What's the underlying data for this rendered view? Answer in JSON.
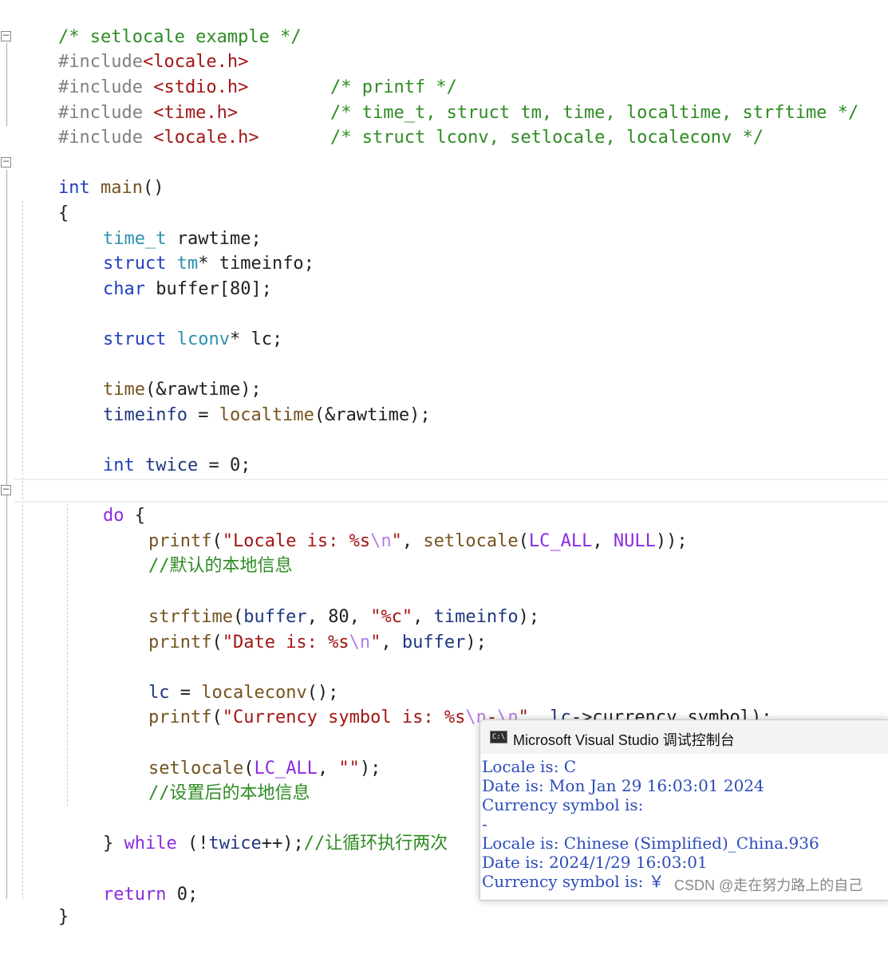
{
  "editor": {
    "lines": {
      "l01": {
        "cmt": "/* setlocale example */"
      },
      "l02": {
        "inc": "#include",
        "hdr": "<locale.h>"
      },
      "l03": {
        "inc": "#include",
        "hdr": "<stdio.h>",
        "cmt": "/* printf */"
      },
      "l04": {
        "inc": "#include",
        "hdr": "<time.h>",
        "cmt": "/* time_t, struct tm, time, localtime, strftime */"
      },
      "l05": {
        "inc": "#include",
        "hdr": "<locale.h>",
        "cmt": "/* struct lconv, setlocale, localeconv */"
      },
      "l07": {
        "kw": "int",
        "fn": "main",
        "punc": "()"
      },
      "l08": {
        "punc": "{"
      },
      "l09": {
        "type": "time_t",
        "var": "rawtime",
        "punc": ";"
      },
      "l10": {
        "kw": "struct",
        "type": "tm",
        "op": "*",
        "var": "timeinfo",
        "punc": ";"
      },
      "l11": {
        "kw": "char",
        "var": "buffer",
        "punc": "[80];"
      },
      "l13": {
        "kw": "struct",
        "type": "lconv",
        "op": "*",
        "var": "lc",
        "punc": ";"
      },
      "l15": {
        "fn": "time",
        "p1": "(&",
        "var": "rawtime",
        "p2": ");"
      },
      "l16": {
        "var": "timeinfo",
        "op": " = ",
        "fn": "localtime",
        "p1": "(&",
        "var2": "rawtime",
        "p2": ");"
      },
      "l18": {
        "kw": "int",
        "var": "twice",
        "op": " = ",
        "num": "0",
        "punc": ";"
      },
      "l20": {
        "kw": "do",
        "punc": " {"
      },
      "l21": {
        "fn": "printf",
        "p1": "(",
        "str1": "\"Locale is: %s",
        "esc": "\\n",
        "str2": "\"",
        "p2": ", ",
        "fn2": "setlocale",
        "p3": "(",
        "mac1": "LC_ALL",
        "p4": ", ",
        "mac2": "NULL",
        "p5": "));"
      },
      "l22": {
        "cmt": "//默认的本地信息"
      },
      "l24": {
        "fn": "strftime",
        "p1": "(",
        "var": "buffer",
        "p2": ", ",
        "num": "80",
        "p3": ", ",
        "str": "\"%c\"",
        "p4": ", ",
        "var2": "timeinfo",
        "p5": ");"
      },
      "l25": {
        "fn": "printf",
        "p1": "(",
        "str1": "\"Date is: %s",
        "esc": "\\n",
        "str2": "\"",
        "p2": ", ",
        "var": "buffer",
        "p3": ");"
      },
      "l27": {
        "var": "lc",
        "op": " = ",
        "fn": "localeconv",
        "punc": "();"
      },
      "l28": {
        "fn": "printf",
        "p1": "(",
        "str1": "\"Currency symbol is: %s",
        "esc1": "\\n",
        "str2": "-",
        "esc2": "\\n",
        "str3": "\"",
        "p2": ", ",
        "var": "lc",
        "op": "->",
        "mem": "currency_symbol",
        "p3": ");"
      },
      "l30": {
        "fn": "setlocale",
        "p1": "(",
        "mac": "LC_ALL",
        "p2": ", ",
        "str": "\"\"",
        "p3": ");"
      },
      "l31": {
        "cmt": "//设置后的本地信息"
      },
      "l33": {
        "punc": "} ",
        "kw": "while",
        "p1": " (!",
        "var": "twice",
        "op": "++",
        "p2": ");",
        "cmt": "//让循环执行两次"
      },
      "l35": {
        "kw": "return",
        "num": " 0",
        "punc": ";"
      },
      "l36": {
        "punc": "}"
      }
    }
  },
  "console": {
    "title": "Microsoft Visual Studio 调试控制台",
    "icon_name": "console-app-icon",
    "icon_text": "C:\\",
    "lines": [
      "Locale is: C",
      "Date is: Mon Jan 29 16:03:01 2024",
      "Currency symbol is:",
      "-",
      "Locale is: Chinese (Simplified)_China.936",
      "Date is: 2024/1/29 16:03:01",
      "Currency symbol is: ￥"
    ]
  },
  "watermark": "CSDN @走在努力路上的自己",
  "colors": {
    "keyword": "#1f3fbd",
    "type": "#2b91af",
    "function": "#74531f",
    "string": "#a31515",
    "comment": "#2e8b23",
    "macro": "#8a2be2",
    "console_text": "#2a4cb8"
  }
}
